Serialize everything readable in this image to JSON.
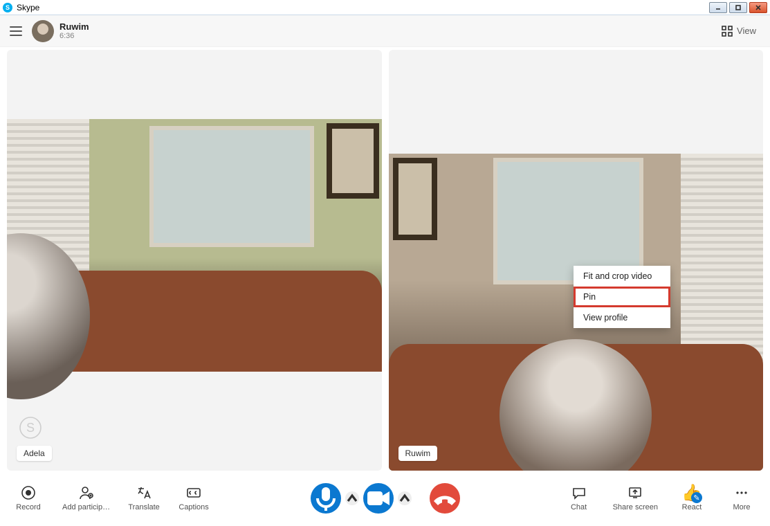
{
  "titlebar": {
    "app_name": "Skype"
  },
  "header": {
    "user_name": "Ruwim",
    "call_duration": "6:36",
    "view_label": "View"
  },
  "tiles": {
    "left_name": "Adela",
    "right_name": "Ruwim"
  },
  "context_menu": {
    "fit_crop": "Fit and crop video",
    "pin": "Pin",
    "view_profile": "View profile"
  },
  "bottombar": {
    "record": "Record",
    "add_participants": "Add particip…",
    "translate": "Translate",
    "captions": "Captions",
    "chat": "Chat",
    "share_screen": "Share screen",
    "react": "React",
    "more": "More"
  }
}
